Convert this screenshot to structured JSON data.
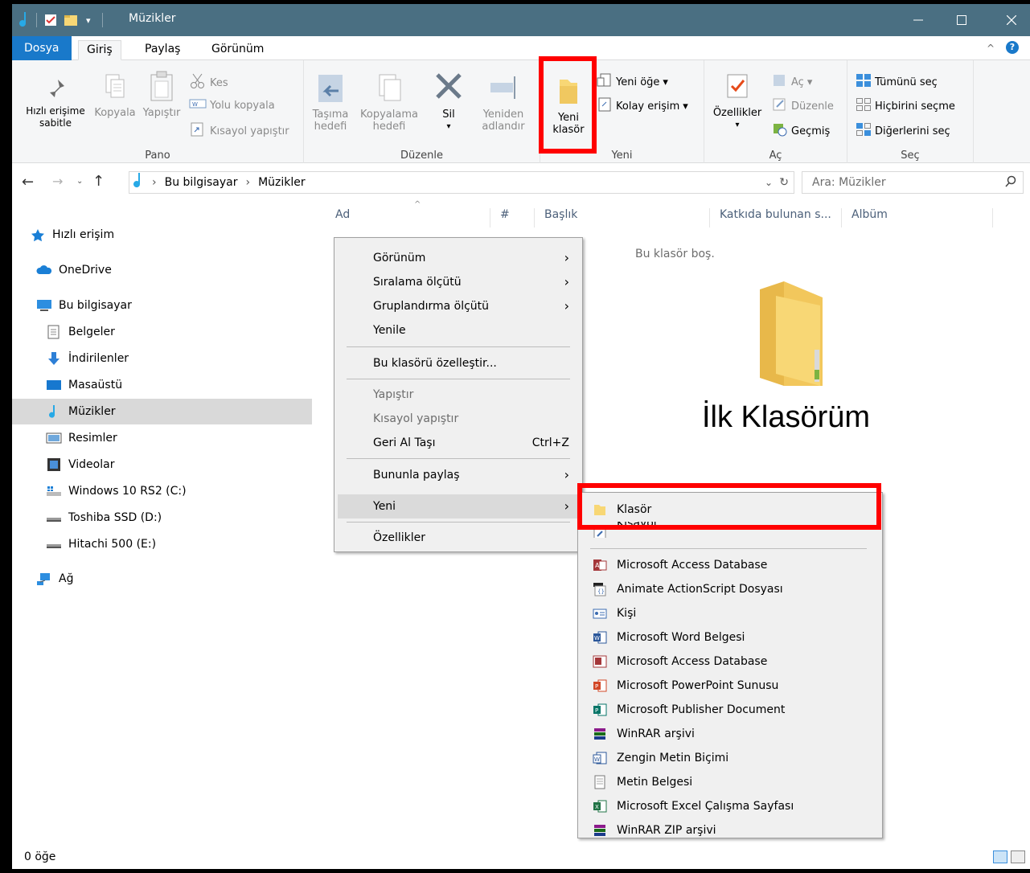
{
  "window": {
    "title": "Müzikler"
  },
  "tabs": {
    "file": "Dosya",
    "home": "Giriş",
    "share": "Paylaş",
    "view": "Görünüm"
  },
  "ribbon": {
    "pin": "Hızlı erişime sabitle",
    "copy": "Kopyala",
    "paste": "Yapıştır",
    "cut": "Kes",
    "copy_path": "Yolu kopyala",
    "paste_shortcut": "Kısayol yapıştır",
    "clipboard_group": "Pano",
    "move_to_1": "Taşıma",
    "move_to_2": "hedefi",
    "copy_to_1": "Kopyalama",
    "copy_to_2": "hedefi",
    "delete": "Sil",
    "rename_1": "Yeniden",
    "rename_2": "adlandır",
    "organize_group": "Düzenle",
    "new_folder_1": "Yeni",
    "new_folder_2": "klasör",
    "new_item": "Yeni öğe",
    "easy_access": "Kolay erişim",
    "new_group": "Yeni",
    "properties": "Özellikler",
    "open": "Aç",
    "edit": "Düzenle",
    "history": "Geçmiş",
    "open_group": "Aç",
    "select_all": "Tümünü seç",
    "select_none": "Hiçbirini seçme",
    "invert_selection": "Diğerlerini seç",
    "select_group": "Seç"
  },
  "address": {
    "pc": "Bu bilgisayar",
    "folder": "Müzikler",
    "search_placeholder": "Ara: Müzikler"
  },
  "nav": {
    "items": [
      "Hızlı erişim",
      "OneDrive",
      "Bu bilgisayar",
      "Belgeler",
      "İndirilenler",
      "Masaüstü",
      "Müzikler",
      "Resimler",
      "Videolar",
      "Windows 10 RS2 (C:)",
      "Toshiba SSD (D:)",
      "Hitachi 500 (E:)",
      "Ağ"
    ]
  },
  "columns": [
    "Ad",
    "#",
    "Başlık",
    "Katkıda bulunan s...",
    "Albüm"
  ],
  "content": {
    "empty": "Bu klasör boş.",
    "big_label": "İlk Klasörüm"
  },
  "context_menu": {
    "view": "Görünüm",
    "sort_by": "Sıralama ölçütü",
    "group_by": "Gruplandırma ölçütü",
    "refresh": "Yenile",
    "customize": "Bu klasörü özelleştir...",
    "paste": "Yapıştır",
    "paste_shortcut": "Kısayol yapıştır",
    "undo": "Geri Al Taşı",
    "undo_shortcut": "Ctrl+Z",
    "share_with": "Bununla paylaş",
    "new": "Yeni",
    "properties": "Özellikler"
  },
  "submenu": {
    "items": [
      "Klasör",
      "Kısayol",
      "Microsoft Access Database",
      "Animate ActionScript Dosyası",
      "Kişi",
      "Microsoft Word Belgesi",
      "Microsoft Access Database",
      "Microsoft PowerPoint Sunusu",
      "Microsoft Publisher Document",
      "WinRAR arşivi",
      "Zengin Metin Biçimi",
      "Metin Belgesi",
      "Microsoft Excel Çalışma Sayfası",
      "WinRAR ZIP arşivi"
    ]
  },
  "status": {
    "count": "0 öğe"
  },
  "colors": {
    "highlight_box": "#ff0000",
    "file_tab": "#1979ca",
    "folder": "#f8d775"
  }
}
